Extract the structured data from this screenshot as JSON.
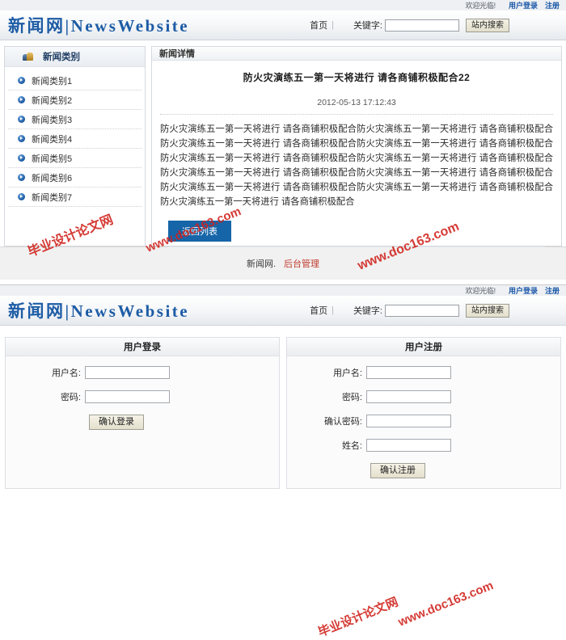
{
  "header": {
    "welcome": "欢迎光临!",
    "login_link": "用户登录",
    "register_link": "注册",
    "logo": "新闻网|NewsWebsite",
    "nav_home": "首页",
    "nav_separator": "|",
    "keyword_label": "关键字:",
    "keyword_value": "",
    "keyword_placeholder": "",
    "search_button": "站内搜索"
  },
  "sidebar": {
    "title": "新闻类别",
    "icon": "users-icon",
    "items": [
      {
        "label": "新闻类别1"
      },
      {
        "label": "新闻类别2"
      },
      {
        "label": "新闻类别3"
      },
      {
        "label": "新闻类别4"
      },
      {
        "label": "新闻类别5"
      },
      {
        "label": "新闻类别6"
      },
      {
        "label": "新闻类别7"
      }
    ]
  },
  "news_detail": {
    "panel_title": "新闻详情",
    "title": "防火灾演练五一第一天将进行  请各商铺积极配合22",
    "date": "2012-05-13 17:12:43",
    "body": "防火灾演练五一第一天将进行  请各商铺积极配合防火灾演练五一第一天将进行  请各商铺积极配合防火灾演练五一第一天将进行  请各商铺积极配合防火灾演练五一第一天将进行  请各商铺积极配合防火灾演练五一第一天将进行  请各商铺积极配合防火灾演练五一第一天将进行  请各商铺积极配合防火灾演练五一第一天将进行  请各商铺积极配合防火灾演练五一第一天将进行  请各商铺积极配合防火灾演练五一第一天将进行  请各商铺积极配合防火灾演练五一第一天将进行  请各商铺积极配合防火灾演练五一第一天将进行  请各商铺积极配合",
    "back_button": "返回列表"
  },
  "footer": {
    "site": "新闻网.",
    "admin_link": "后台管理"
  },
  "login_panel": {
    "title": "用户登录",
    "fields": [
      {
        "label": "用户名:",
        "value": "",
        "name": "username-field"
      },
      {
        "label": "密码:",
        "value": "",
        "name": "password-field"
      }
    ],
    "submit": "确认登录"
  },
  "register_panel": {
    "title": "用户注册",
    "fields": [
      {
        "label": "用户名:",
        "value": "",
        "name": "reg-username-field"
      },
      {
        "label": "密码:",
        "value": "",
        "name": "reg-password-field"
      },
      {
        "label": "确认密码:",
        "value": "",
        "name": "reg-confirm-password-field"
      },
      {
        "label": "姓名:",
        "value": "",
        "name": "reg-realname-field"
      }
    ],
    "submit": "确认注册"
  },
  "watermarks": {
    "a": "毕业设计论文网",
    "b": "www.doc163.com",
    "c": "www.doc163.com",
    "d": "毕业设计论文网",
    "e": "www.doc163.com",
    "f": "www.doc163.com"
  },
  "colors": {
    "brand_blue": "#1d5ca5",
    "link_blue": "#1b58a8",
    "button_blue": "#1565a8",
    "admin_red": "#c0392b",
    "watermark_red": "#d0211b"
  }
}
